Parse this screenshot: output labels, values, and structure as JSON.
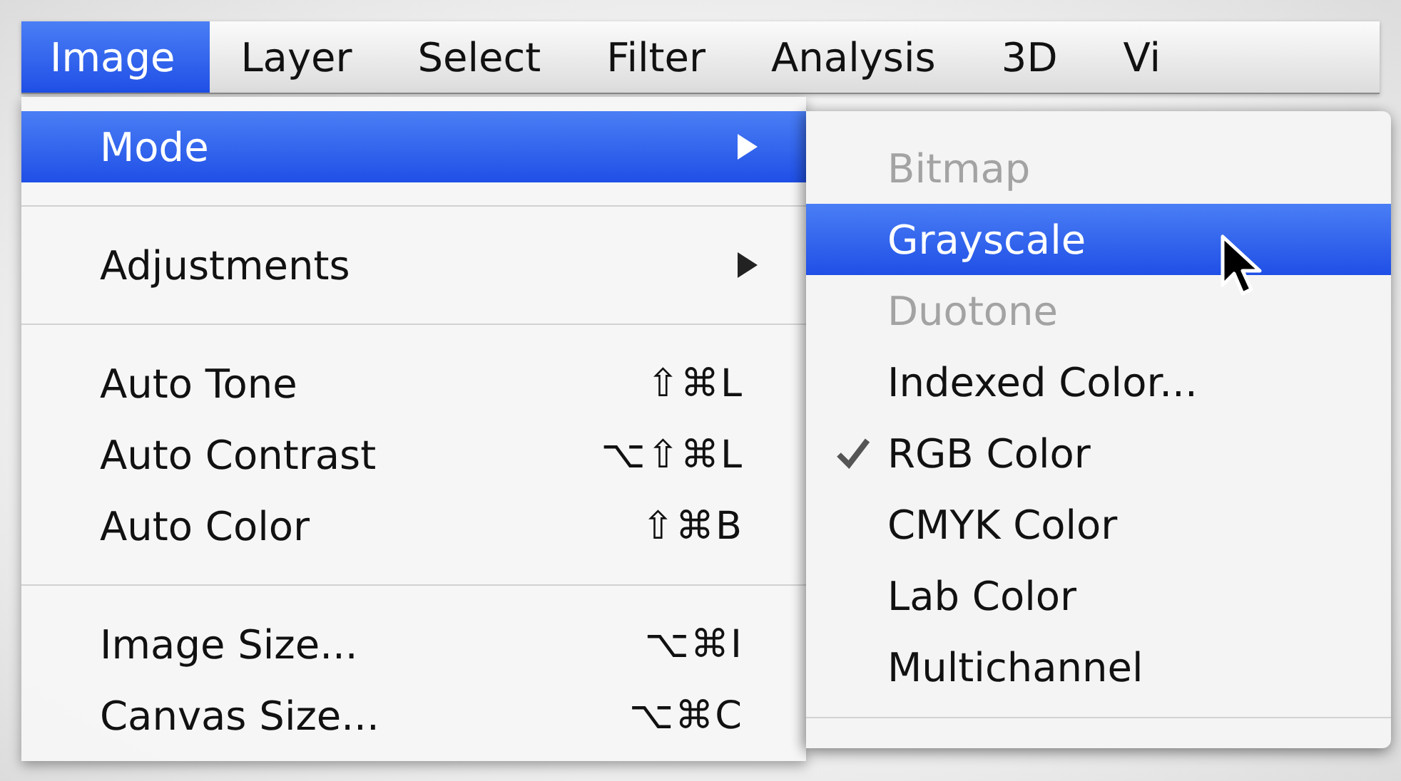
{
  "menubar": [
    {
      "label": "Image",
      "selected": true
    },
    {
      "label": "Layer",
      "selected": false
    },
    {
      "label": "Select",
      "selected": false
    },
    {
      "label": "Filter",
      "selected": false
    },
    {
      "label": "Analysis",
      "selected": false
    },
    {
      "label": "3D",
      "selected": false
    },
    {
      "label": "Vi",
      "selected": false
    }
  ],
  "menu": {
    "items": [
      {
        "kind": "item",
        "label": "Mode",
        "submenu": true,
        "selected": true
      },
      {
        "kind": "separator"
      },
      {
        "kind": "item",
        "label": "Adjustments",
        "submenu": true,
        "selected": false
      },
      {
        "kind": "separator"
      },
      {
        "kind": "item",
        "label": "Auto Tone",
        "shortcut": "⇧⌘L",
        "selected": false
      },
      {
        "kind": "item",
        "label": "Auto Contrast",
        "shortcut": "⌥⇧⌘L",
        "selected": false
      },
      {
        "kind": "item",
        "label": "Auto Color",
        "shortcut": "⇧⌘B",
        "selected": false
      },
      {
        "kind": "separator"
      },
      {
        "kind": "item",
        "label": "Image Size...",
        "shortcut": "⌥⌘I",
        "selected": false
      },
      {
        "kind": "item",
        "label": "Canvas Size...",
        "shortcut": "⌥⌘C",
        "selected": false
      }
    ]
  },
  "submenu": {
    "items": [
      {
        "kind": "item",
        "label": "Bitmap",
        "disabled": true,
        "selected": false,
        "checked": false
      },
      {
        "kind": "item",
        "label": "Grayscale",
        "disabled": false,
        "selected": true,
        "checked": false
      },
      {
        "kind": "item",
        "label": "Duotone",
        "disabled": true,
        "selected": false,
        "checked": false
      },
      {
        "kind": "item",
        "label": "Indexed Color...",
        "disabled": false,
        "selected": false,
        "checked": false
      },
      {
        "kind": "item",
        "label": "RGB Color",
        "disabled": false,
        "selected": false,
        "checked": true
      },
      {
        "kind": "item",
        "label": "CMYK Color",
        "disabled": false,
        "selected": false,
        "checked": false
      },
      {
        "kind": "item",
        "label": "Lab Color",
        "disabled": false,
        "selected": false,
        "checked": false
      },
      {
        "kind": "item",
        "label": "Multichannel",
        "disabled": false,
        "selected": false,
        "checked": false
      },
      {
        "kind": "separator"
      }
    ]
  }
}
